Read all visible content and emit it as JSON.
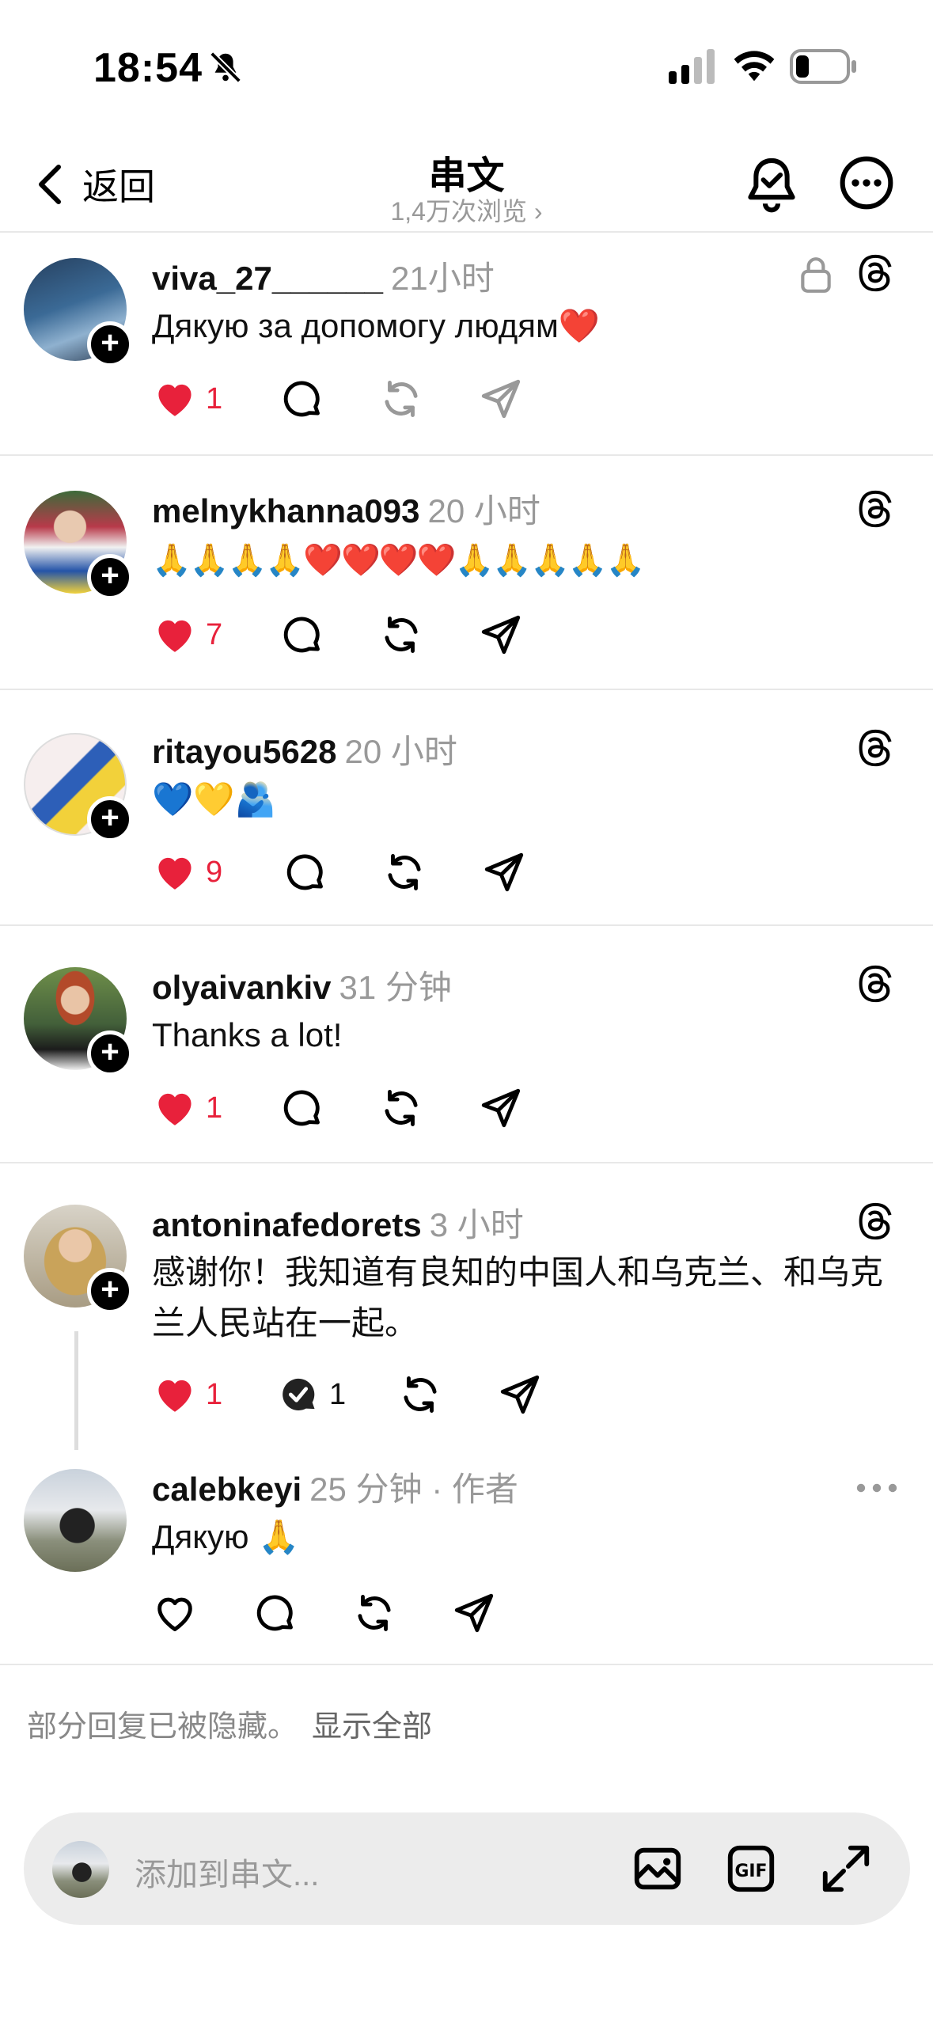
{
  "status_bar": {
    "time": "18:54"
  },
  "header": {
    "back_label": "返回",
    "title": "串文",
    "views": "1,4万次浏览 ›"
  },
  "posts": [
    {
      "username": "viva_27______",
      "time": "21小时",
      "text": "Дякую за допомогу людям❤️",
      "likes": "1",
      "liked": true,
      "locked": true
    },
    {
      "username": "melnykhanna093",
      "time": "20 小时",
      "text": "🙏🙏🙏🙏❤️❤️❤️❤️🙏🙏🙏🙏🙏",
      "likes": "7",
      "liked": true
    },
    {
      "username": "ritayou5628",
      "time": "20 小时",
      "text": "💙💛🫂",
      "likes": "9",
      "liked": true
    },
    {
      "username": "olyaivankiv",
      "time": "31 分钟",
      "text": "Thanks a lot!",
      "likes": "1",
      "liked": true
    },
    {
      "username": "antoninafedorets",
      "time": "3 小时",
      "text": "感谢你！我知道有良知的中国人和乌克兰、和乌克兰人民站在一起。",
      "likes": "1",
      "replies": "1",
      "liked": true
    },
    {
      "username": "calebkeyi",
      "time": "25 分钟 · 作者",
      "text": "Дякую 🙏",
      "liked": false
    }
  ],
  "hidden_note": {
    "text": "部分回复已被隐藏。",
    "link": "显示全部"
  },
  "composer": {
    "placeholder": "添加到串文..."
  },
  "colors": {
    "like_red": "#e8213b",
    "meta_gray": "#999999"
  }
}
